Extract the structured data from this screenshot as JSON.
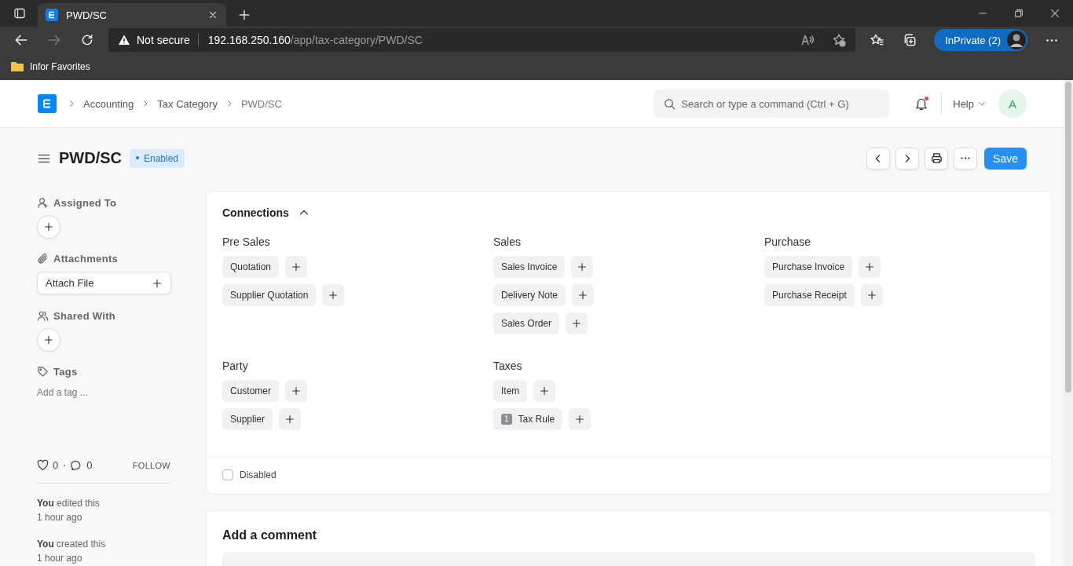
{
  "browser": {
    "tab_title": "PWD/SC",
    "security": "Not secure",
    "url_host": "192.168.250.160",
    "url_path": "/app/tax-category/PWD/SC",
    "profile": "InPrivate (2)",
    "favorites": [
      {
        "label": "Infor Favorites"
      }
    ]
  },
  "navbar": {
    "breadcrumbs": [
      "Accounting",
      "Tax Category",
      "PWD/SC"
    ],
    "search": {
      "placeholder": "Search or type a command (Ctrl + G)"
    },
    "notification_unread": true,
    "help": "Help",
    "avatar": "A"
  },
  "page": {
    "title": "PWD/SC",
    "status": "Enabled",
    "save": "Save"
  },
  "sidebar": {
    "assigned_to": "Assigned To",
    "attachments": "Attachments",
    "attach_file": "Attach File",
    "shared_with": "Shared With",
    "tags": "Tags",
    "add_tag": "Add a tag ...",
    "likes": "0",
    "comments": "0",
    "follow": "FOLLOW",
    "activity": [
      {
        "text": "**You** edited this",
        "time": "1 hour ago"
      },
      {
        "text": "**You** created this",
        "time": "1 hour ago"
      }
    ]
  },
  "connections": {
    "title": "Connections",
    "expanded": true,
    "groups": [
      {
        "name": "Pre Sales",
        "links": [
          {
            "label": "Quotation"
          },
          {
            "label": "Supplier Quotation"
          }
        ]
      },
      {
        "name": "Sales",
        "links": [
          {
            "label": "Sales Invoice"
          },
          {
            "label": "Delivery Note"
          },
          {
            "label": "Sales Order"
          }
        ]
      },
      {
        "name": "Purchase",
        "links": [
          {
            "label": "Purchase Invoice"
          },
          {
            "label": "Purchase Receipt"
          }
        ]
      },
      {
        "name": "Party",
        "links": [
          {
            "label": "Customer"
          },
          {
            "label": "Supplier"
          }
        ]
      },
      {
        "name": "Taxes",
        "links": [
          {
            "label": "Item"
          },
          {
            "label": "Tax Rule",
            "count": "1"
          }
        ]
      }
    ]
  },
  "disabled_field": {
    "label": "Disabled",
    "checked": false
  },
  "comment": {
    "title": "Add a comment"
  }
}
